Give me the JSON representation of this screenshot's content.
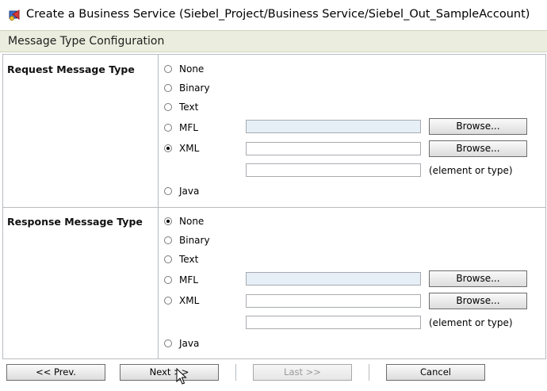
{
  "window": {
    "title": "Create a Business Service (Siebel_Project/Business Service/Siebel_Out_SampleAccount)"
  },
  "section": {
    "title": "Message Type Configuration"
  },
  "request": {
    "label": "Request Message Type",
    "options": {
      "none": "None",
      "binary": "Binary",
      "text": "Text",
      "mfl": "MFL",
      "xml": "XML",
      "java": "Java"
    },
    "selected": "XML",
    "mfl_value": "",
    "xml_value": "",
    "element_value": "",
    "browse_label": "Browse...",
    "element_hint": "(element or type)"
  },
  "response": {
    "label": "Response Message Type",
    "options": {
      "none": "None",
      "binary": "Binary",
      "text": "Text",
      "mfl": "MFL",
      "xml": "XML",
      "java": "Java"
    },
    "selected": "None",
    "mfl_value": "",
    "xml_value": "",
    "element_value": "",
    "browse_label": "Browse...",
    "element_hint": "(element or type)"
  },
  "nav": {
    "prev": "<< Prev.",
    "next": "Next >>",
    "last": "Last >>",
    "cancel": "Cancel"
  },
  "icons": {
    "title": "business-service-icon",
    "pointer": "mouse-cursor-icon"
  },
  "colors": {
    "section_bg": "#ebeede",
    "disabled_field_bg": "#e6eef6"
  }
}
